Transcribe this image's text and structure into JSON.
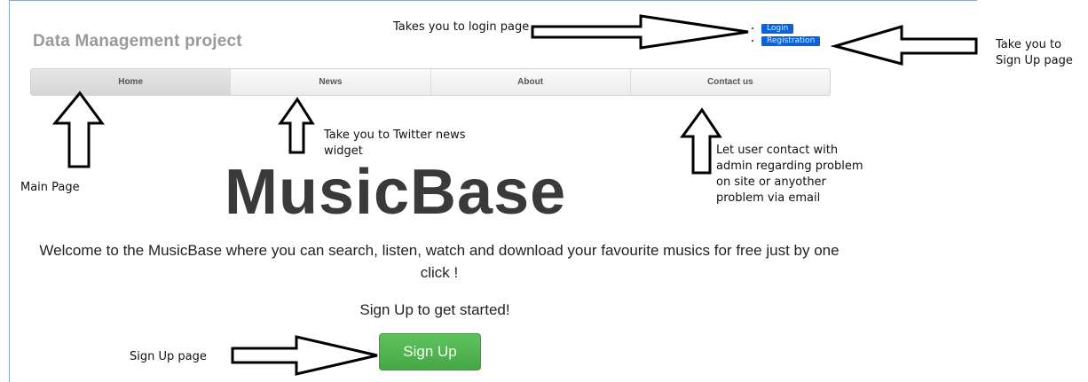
{
  "site": {
    "title": "Data Management project"
  },
  "auth": {
    "login_label": "Login",
    "registration_label": "Registration"
  },
  "nav": {
    "items": [
      {
        "label": "Home"
      },
      {
        "label": "News"
      },
      {
        "label": "About"
      },
      {
        "label": "Contact us"
      }
    ]
  },
  "hero": {
    "title": "MusicBase"
  },
  "welcome": {
    "text": "Welcome to the MusicBase where you can search, listen, watch and download your favourite musics for free just by one click !"
  },
  "cta": {
    "text": "Sign Up to get started!",
    "button_label": "Sign Up"
  },
  "annotations": {
    "login": "Takes you to login page",
    "registration": "Take you to Sign Up page",
    "home": "Main Page",
    "news": "Take you to Twitter news widget",
    "contact": "Let user contact with admin regarding problem on site or anyother problem via email",
    "signup": "Sign Up page"
  },
  "colors": {
    "accent_blue": "#0b63d6",
    "signup_green": "#4cb84c",
    "title_gray": "#999999"
  }
}
